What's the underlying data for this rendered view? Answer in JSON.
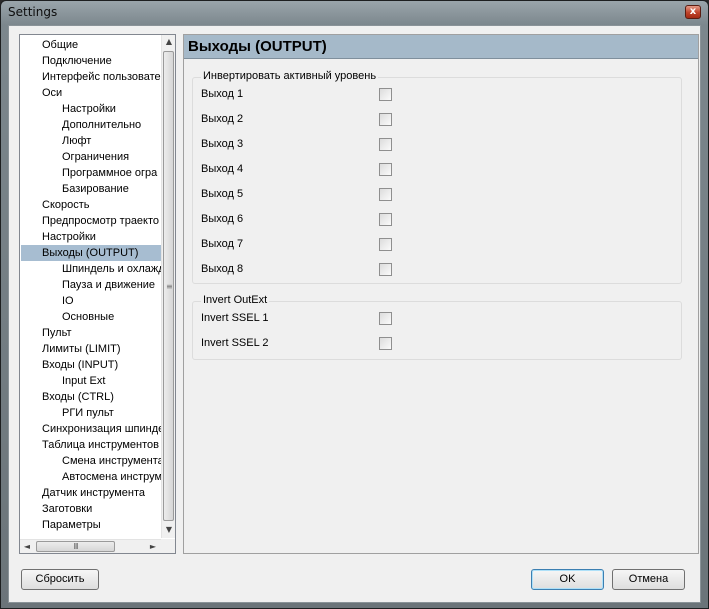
{
  "window": {
    "title": "Settings",
    "close_glyph": "x"
  },
  "tree": {
    "items": [
      {
        "label": "Общие",
        "level": 1
      },
      {
        "label": "Подключение",
        "level": 1
      },
      {
        "label": "Интерфейс пользовате",
        "level": 1
      },
      {
        "label": "Оси",
        "level": 1
      },
      {
        "label": "Настройки",
        "level": 2
      },
      {
        "label": "Дополнительно",
        "level": 2
      },
      {
        "label": "Люфт",
        "level": 2
      },
      {
        "label": "Ограничения",
        "level": 2
      },
      {
        "label": "Программное огра",
        "level": 2
      },
      {
        "label": "Базирование",
        "level": 2
      },
      {
        "label": "Скорость",
        "level": 1
      },
      {
        "label": "Предпросмотр траекто",
        "level": 1
      },
      {
        "label": "Настройки",
        "level": 1
      },
      {
        "label": "Выходы (OUTPUT)",
        "level": 1,
        "selected": true
      },
      {
        "label": "Шпиндель и охлажд",
        "level": 2
      },
      {
        "label": "Пауза и движение",
        "level": 2
      },
      {
        "label": "IO",
        "level": 2
      },
      {
        "label": "Основные",
        "level": 2
      },
      {
        "label": "Пульт",
        "level": 1
      },
      {
        "label": "Лимиты (LIMIT)",
        "level": 1
      },
      {
        "label": "Входы (INPUT)",
        "level": 1
      },
      {
        "label": "Input Ext",
        "level": 2
      },
      {
        "label": "Входы (CTRL)",
        "level": 1
      },
      {
        "label": "РГИ пульт",
        "level": 2
      },
      {
        "label": "Синхронизация шпинде",
        "level": 1
      },
      {
        "label": "Таблица инструментов",
        "level": 1
      },
      {
        "label": "Смена инструмента",
        "level": 2
      },
      {
        "label": "Автосмена инструм",
        "level": 2
      },
      {
        "label": "Датчик инструмента",
        "level": 1
      },
      {
        "label": "Заготовки",
        "level": 1
      },
      {
        "label": "Параметры",
        "level": 1
      }
    ],
    "scroll_up": "▲",
    "scroll_down": "▼",
    "scroll_left": "◄",
    "scroll_right": "►",
    "hgrip": "III",
    "vgrip": "≡"
  },
  "page": {
    "title": "Выходы (OUTPUT)",
    "groups": [
      {
        "title": "Инвертировать активный уровень",
        "options": [
          {
            "label": "Выход 1",
            "checked": false
          },
          {
            "label": "Выход 2",
            "checked": false
          },
          {
            "label": "Выход 3",
            "checked": false
          },
          {
            "label": "Выход 4",
            "checked": false
          },
          {
            "label": "Выход 5",
            "checked": false
          },
          {
            "label": "Выход 6",
            "checked": false
          },
          {
            "label": "Выход 7",
            "checked": false
          },
          {
            "label": "Выход 8",
            "checked": false
          }
        ]
      },
      {
        "title": "Invert OutExt",
        "options": [
          {
            "label": "Invert SSEL 1",
            "checked": false
          },
          {
            "label": "Invert SSEL 2",
            "checked": false
          }
        ]
      }
    ]
  },
  "buttons": {
    "reset": "Сбросить",
    "ok": "OK",
    "cancel": "Отмена"
  }
}
